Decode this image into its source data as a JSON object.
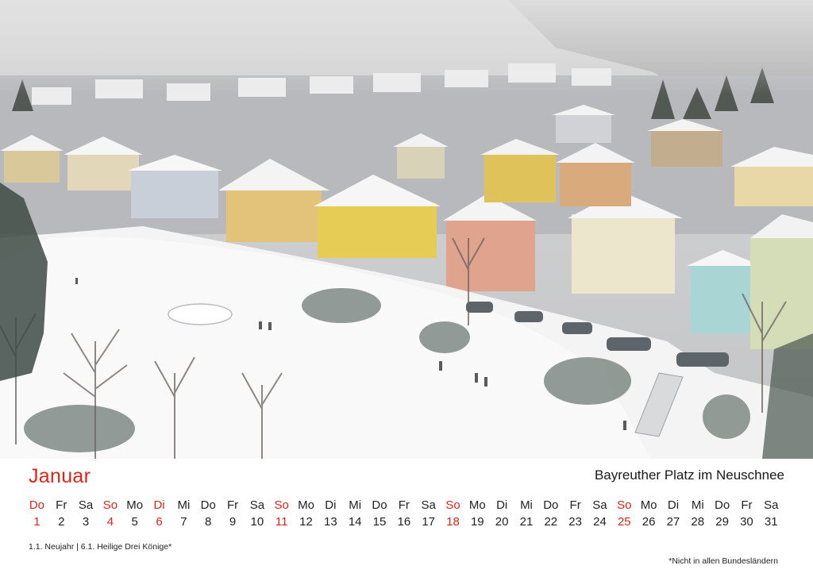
{
  "photo": {
    "icon": "winter-village-photo"
  },
  "header": {
    "month": "Januar",
    "caption": "Bayreuther Platz im Neuschnee"
  },
  "calendar": {
    "days": [
      {
        "wd": "Do",
        "d": "1",
        "red": true
      },
      {
        "wd": "Fr",
        "d": "2",
        "red": false
      },
      {
        "wd": "Sa",
        "d": "3",
        "red": false
      },
      {
        "wd": "So",
        "d": "4",
        "red": true
      },
      {
        "wd": "Mo",
        "d": "5",
        "red": false
      },
      {
        "wd": "Di",
        "d": "6",
        "red": true
      },
      {
        "wd": "Mi",
        "d": "7",
        "red": false
      },
      {
        "wd": "Do",
        "d": "8",
        "red": false
      },
      {
        "wd": "Fr",
        "d": "9",
        "red": false
      },
      {
        "wd": "Sa",
        "d": "10",
        "red": false
      },
      {
        "wd": "So",
        "d": "11",
        "red": true
      },
      {
        "wd": "Mo",
        "d": "12",
        "red": false
      },
      {
        "wd": "Di",
        "d": "13",
        "red": false
      },
      {
        "wd": "Mi",
        "d": "14",
        "red": false
      },
      {
        "wd": "Do",
        "d": "15",
        "red": false
      },
      {
        "wd": "Fr",
        "d": "16",
        "red": false
      },
      {
        "wd": "Sa",
        "d": "17",
        "red": false
      },
      {
        "wd": "So",
        "d": "18",
        "red": true
      },
      {
        "wd": "Mo",
        "d": "19",
        "red": false
      },
      {
        "wd": "Di",
        "d": "20",
        "red": false
      },
      {
        "wd": "Mi",
        "d": "21",
        "red": false
      },
      {
        "wd": "Do",
        "d": "22",
        "red": false
      },
      {
        "wd": "Fr",
        "d": "23",
        "red": false
      },
      {
        "wd": "Sa",
        "d": "24",
        "red": false
      },
      {
        "wd": "So",
        "d": "25",
        "red": true
      },
      {
        "wd": "Mo",
        "d": "26",
        "red": false
      },
      {
        "wd": "Di",
        "d": "27",
        "red": false
      },
      {
        "wd": "Mi",
        "d": "28",
        "red": false
      },
      {
        "wd": "Do",
        "d": "29",
        "red": false
      },
      {
        "wd": "Fr",
        "d": "30",
        "red": false
      },
      {
        "wd": "Sa",
        "d": "31",
        "red": false
      }
    ]
  },
  "footer": {
    "holidays": "1.1. Neujahr | 6.1. Heilige Drei Könige*",
    "footnote": "*Nicht in allen Bundesländern"
  },
  "colors": {
    "accent": "#e2231a",
    "text": "#222222"
  }
}
